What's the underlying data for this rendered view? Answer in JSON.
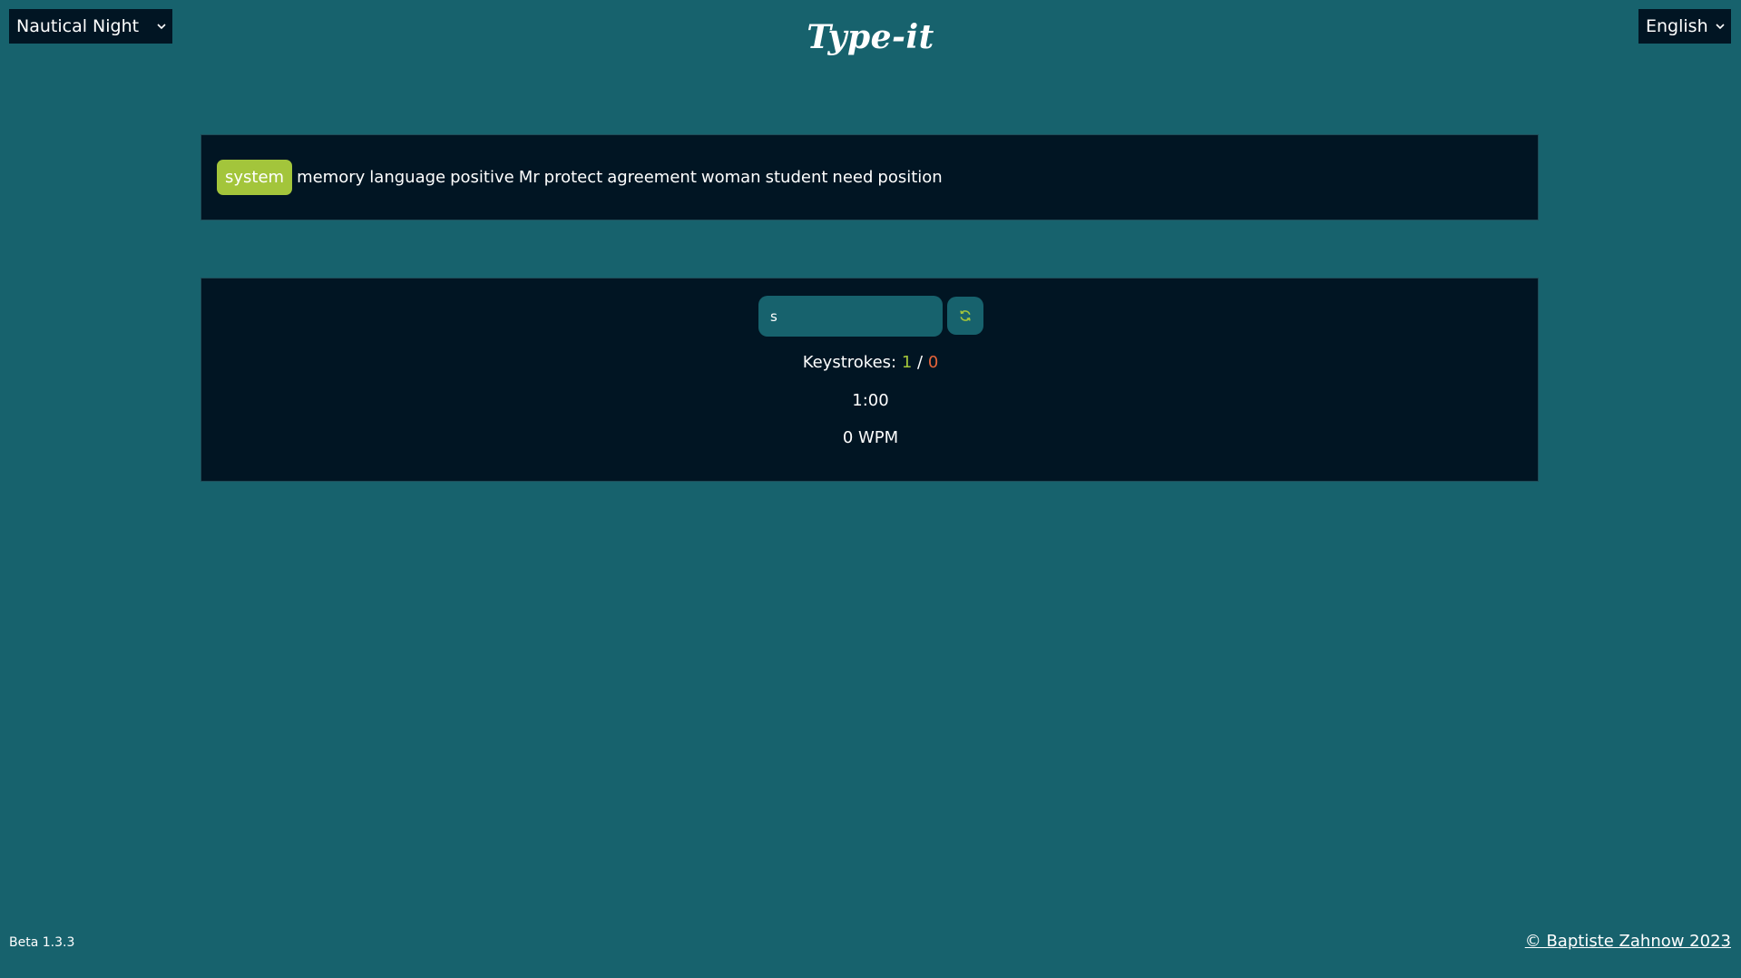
{
  "header": {
    "theme_select": {
      "value": "Nautical Night"
    },
    "title": "Type-it",
    "language_select": {
      "value": "English"
    }
  },
  "words": {
    "current": "system",
    "upcoming": [
      "memory",
      "language",
      "positive",
      "Mr",
      "protect",
      "agreement",
      "woman",
      "student",
      "need",
      "position"
    ]
  },
  "typing": {
    "input_value": "s",
    "keystrokes_label": "Keystrokes:",
    "correct_count": "1",
    "separator": "/",
    "wrong_count": "0",
    "timer": "1:00",
    "wpm": "0 WPM"
  },
  "footer": {
    "version": "Beta 1.3.3",
    "copyright": "© Baptiste Zahnow 2023"
  },
  "colors": {
    "background": "#17626d",
    "panel": "#011523",
    "accent_green": "#a3c53b",
    "error_orange": "#e8643a"
  },
  "icons": {
    "refresh": "refresh-icon",
    "dropdown": "chevron-down-icon"
  }
}
